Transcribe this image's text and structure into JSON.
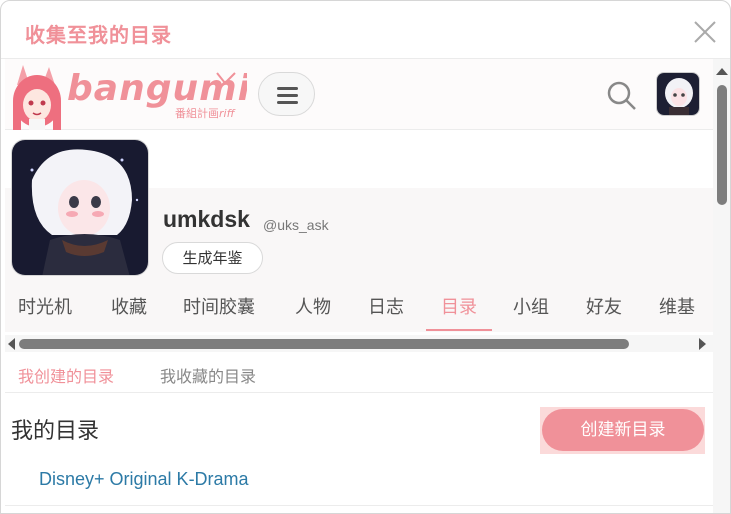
{
  "dialog": {
    "title": "收集至我的目录"
  },
  "navbar": {
    "logo_text": "bangumi",
    "logo_subtext": "番組計画",
    "logo_tag": "riff",
    "icons": [
      "mascot-icon",
      "menu-icon",
      "search-icon",
      "avatar"
    ]
  },
  "profile": {
    "username": "umkdsk",
    "handle": "@uks_ask",
    "yearbook_label": "生成年鉴"
  },
  "tabs": [
    {
      "label": "时光机"
    },
    {
      "label": "收藏"
    },
    {
      "label": "时间胶囊"
    },
    {
      "label": "人物"
    },
    {
      "label": "日志"
    },
    {
      "label": "目录"
    },
    {
      "label": "小组"
    },
    {
      "label": "好友"
    },
    {
      "label": "维基"
    }
  ],
  "active_tab": "目录",
  "subtabs": [
    {
      "label": "我创建的目录"
    },
    {
      "label": "我收藏的目录"
    }
  ],
  "active_subtab": "我创建的目录",
  "section": {
    "title": "我的目录",
    "create_label": "创建新目录"
  },
  "catalog_items": [
    {
      "title": "Disney+ Original K-Drama"
    }
  ],
  "colors": {
    "accent": "#f09199",
    "link": "#2c7aa6",
    "text": "#333333"
  }
}
